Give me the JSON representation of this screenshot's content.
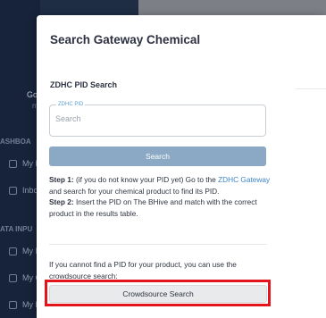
{
  "sidebar": {
    "user_name": "Gol",
    "user_sub": "m",
    "section_dashboard": "ASHBOA",
    "section_data_input": "ATA INPU",
    "items": [
      {
        "label": "My D",
        "icon": "grid-icon"
      },
      {
        "label": "Inbo",
        "icon": "inbox-icon"
      },
      {
        "label": "My I",
        "icon": "document-icon"
      },
      {
        "label": "My C",
        "icon": "document-icon"
      },
      {
        "label": "My F",
        "icon": "document-icon"
      }
    ]
  },
  "modal": {
    "title": "Search Gateway Chemical",
    "section_title": "ZDHC PID Search",
    "field_label": "ZDHC PID",
    "field_placeholder": "Search",
    "field_value": "",
    "search_button": "Search",
    "step1_label": "Step 1:",
    "step1_text": " (if you do not know your PID yet) Go to the ",
    "step1_link": "ZDHC Gateway",
    "step1_text2": " and search for your chemical product to find its PID.",
    "step2_label": "Step 2:",
    "step2_text": " Insert the PID on The BHive and match with the correct product in the results table.",
    "crowdsource_text": "If you cannot find a PID for your product, you can use the crowdsource search:",
    "crowdsource_button": "Crowdsource Search"
  },
  "colors": {
    "accent": "#3d86c6",
    "search_button_bg": "#8ba9c5",
    "highlight": "#e3141b",
    "sidebar_bg": "#16233a"
  }
}
